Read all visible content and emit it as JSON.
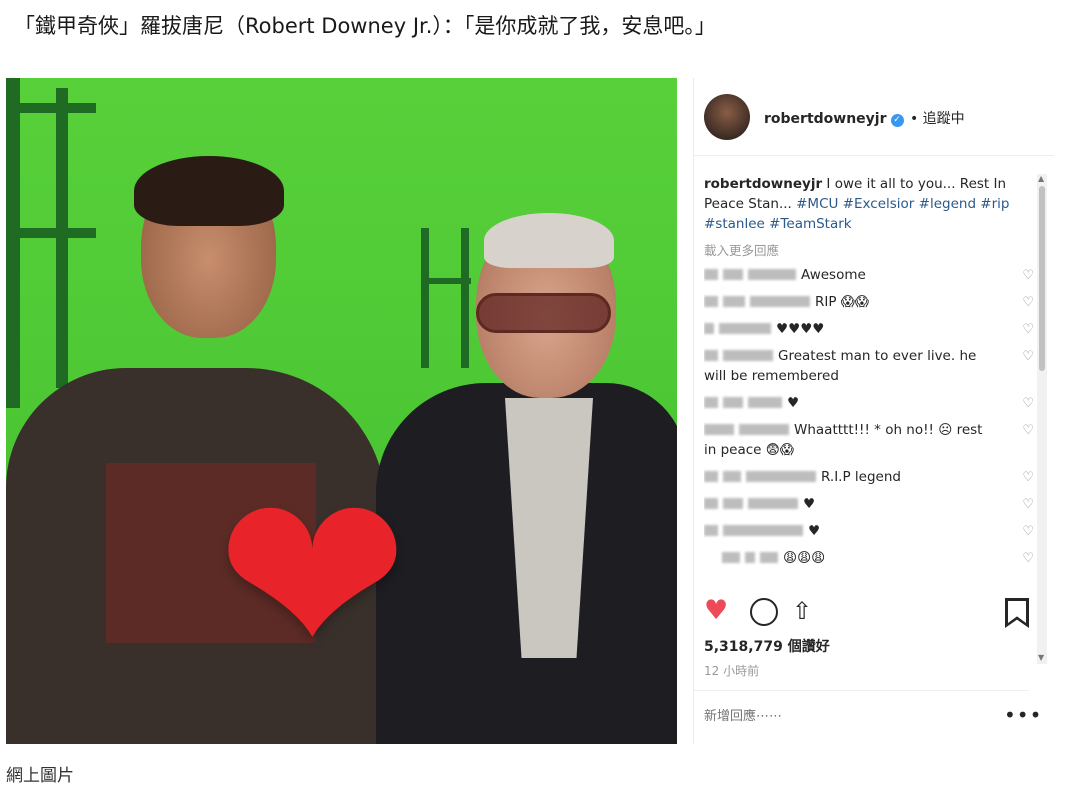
{
  "headline": "「鐵甲奇俠」羅拔唐尼（Robert Downey Jr.）：「是你成就了我，安息吧。」",
  "image_caption": "網上圖片",
  "colors": {
    "like_red": "#ed4956",
    "heart_emoji": "#e8232a",
    "hashtag_blue": "#2a5a8a",
    "green_screen": "#4ec935"
  },
  "photo": {
    "overlay_emoji": "heart"
  },
  "instagram": {
    "username": "robertdowneyjr",
    "verified_icon": "verified-badge-icon",
    "follow_status": "• 追蹤中",
    "caption_user": "robertdowneyjr",
    "caption_text": "I owe it all to you... Rest In Peace Stan...",
    "caption_tags": "#MCU #Excelsior #legend #rip #stanlee #TeamStark",
    "load_more": "載入更多回應",
    "comments": [
      {
        "text": "Awesome"
      },
      {
        "text": "RIP 😱😱"
      },
      {
        "text": "♥♥♥♥"
      },
      {
        "text": "Greatest man to ever live. he will be remembered"
      },
      {
        "text": "♥"
      },
      {
        "text": "Whaatttt!!! * oh no!! ☹ rest in peace 😨😱"
      },
      {
        "text": "R.I.P legend"
      },
      {
        "text": "♥"
      },
      {
        "text": "♥"
      },
      {
        "text": "😩😩😩"
      }
    ],
    "likes": "5,318,779 個讚好",
    "time_ago": "12 小時前",
    "add_comment_placeholder": "新增回應⋯⋯",
    "more_options": "•••"
  }
}
